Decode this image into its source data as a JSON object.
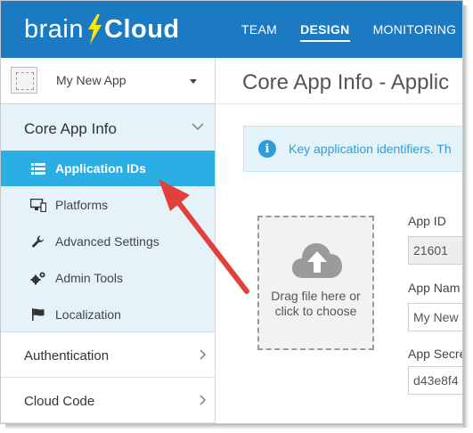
{
  "header": {
    "logo_left": "brain",
    "logo_right": "Cloud",
    "tabs": [
      {
        "label": "TEAM",
        "active": false
      },
      {
        "label": "DESIGN",
        "active": true
      },
      {
        "label": "MONITORING",
        "active": false
      }
    ],
    "background": "#1c7ac2"
  },
  "sidebar": {
    "app_name": "My New App",
    "section": {
      "title": "Core App Info",
      "expanded": true,
      "items": [
        {
          "label": "Application IDs",
          "icon": "list-icon",
          "active": true
        },
        {
          "label": "Platforms",
          "icon": "monitor-icon",
          "active": false
        },
        {
          "label": "Advanced Settings",
          "icon": "wrench-icon",
          "active": false
        },
        {
          "label": "Admin Tools",
          "icon": "gears-icon",
          "active": false
        },
        {
          "label": "Localization",
          "icon": "flag-icon",
          "active": false
        }
      ]
    },
    "collapsed_sections": [
      {
        "label": "Authentication"
      },
      {
        "label": "Cloud Code"
      }
    ],
    "active_color": "#2aaee3",
    "section_bg": "#e5f2fa"
  },
  "main": {
    "title": "Core App Info - Applic",
    "info_text": "Key application identifiers. Th",
    "dropzone_text": "Drag file here or click to choose",
    "fields": [
      {
        "label": "App ID",
        "value": "21601"
      },
      {
        "label": "App Nam",
        "value": "My New"
      },
      {
        "label": "App Secre",
        "value": "d43e8f4"
      }
    ]
  },
  "annotation": {
    "color": "#e2403a",
    "points_to": "Application IDs"
  }
}
